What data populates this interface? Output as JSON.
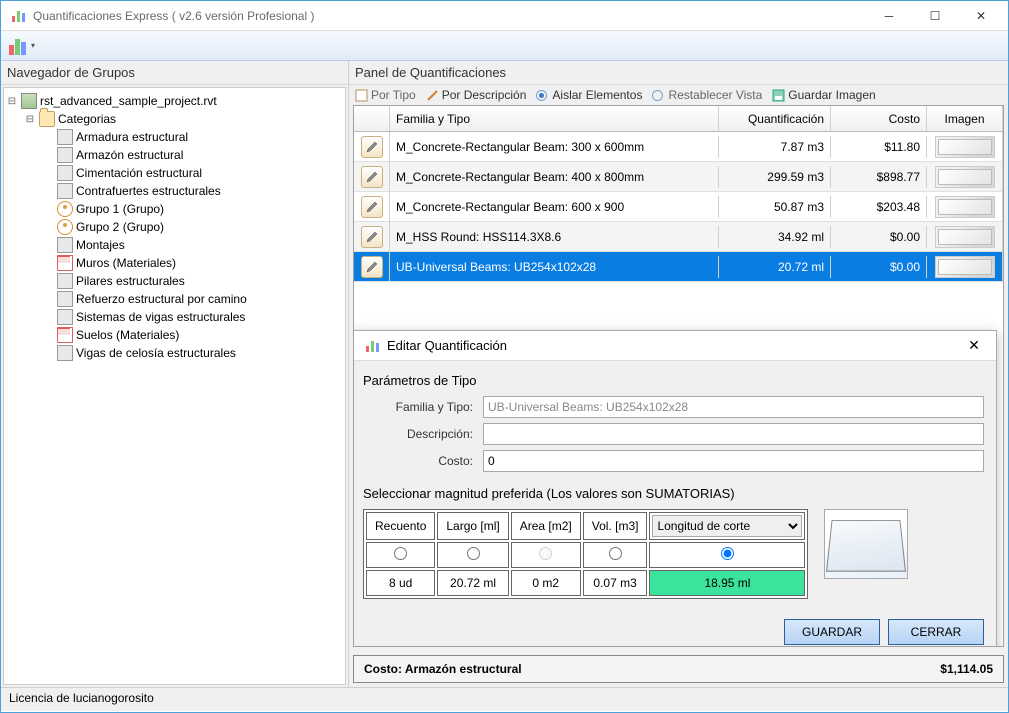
{
  "window": {
    "title": "Quantificaciones Express ( v2.6 versión Profesional )"
  },
  "nav": {
    "title": "Navegador de Grupos",
    "root": "rst_advanced_sample_project.rvt",
    "cat": "Categorias",
    "items": [
      {
        "label": "Armadura estructural",
        "icon": "igray"
      },
      {
        "label": "Armazón estructural",
        "icon": "igray"
      },
      {
        "label": "Cimentación estructural",
        "icon": "igray"
      },
      {
        "label": "Contrafuertes estructurales",
        "icon": "igray"
      },
      {
        "label": "Grupo 1 (Grupo)",
        "icon": "igrp"
      },
      {
        "label": "Grupo 2 (Grupo)",
        "icon": "igrp"
      },
      {
        "label": "Montajes",
        "icon": "igray"
      },
      {
        "label": "Muros (Materiales)",
        "icon": "imat"
      },
      {
        "label": "Pilares estructurales",
        "icon": "igray"
      },
      {
        "label": "Refuerzo estructural  por camino",
        "icon": "igray"
      },
      {
        "label": "Sistemas de vigas estructurales",
        "icon": "igray"
      },
      {
        "label": "Suelos (Materiales)",
        "icon": "imat"
      },
      {
        "label": "Vigas de celosía estructurales",
        "icon": "igray"
      }
    ]
  },
  "panel": {
    "title": "Panel de Quantificaciones",
    "btns": {
      "tipo": "Por Tipo",
      "desc": "Por Descripción",
      "aislar": "Aislar Elementos",
      "reset": "Restablecer Vista",
      "img": "Guardar Imagen"
    },
    "headers": {
      "name": "Familia y Tipo",
      "quant": "Quantificación",
      "cost": "Costo",
      "img": "Imagen"
    },
    "rows": [
      {
        "name": "M_Concrete-Rectangular Beam: 300 x 600mm",
        "quant": "7.87 m3",
        "cost": "$11.80"
      },
      {
        "name": "M_Concrete-Rectangular Beam: 400 x 800mm",
        "quant": "299.59 m3",
        "cost": "$898.77"
      },
      {
        "name": "M_Concrete-Rectangular Beam: 600 x 900",
        "quant": "50.87 m3",
        "cost": "$203.48"
      },
      {
        "name": "M_HSS Round: HSS114.3X8.6",
        "quant": "34.92 ml",
        "cost": "$0.00"
      },
      {
        "name": "UB-Universal Beams: UB254x102x28",
        "quant": "20.72 ml",
        "cost": "$0.00"
      }
    ],
    "total_label": "Costo: Armazón estructural",
    "total": "$1,114.05"
  },
  "dlg": {
    "title": "Editar Quantificación",
    "section": "Parámetros de Tipo",
    "familia_label": "Familia y Tipo:",
    "familia_val": "UB-Universal Beams: UB254x102x28",
    "desc_label": "Descripción:",
    "desc_val": "",
    "costo_label": "Costo:",
    "costo_val": "0",
    "mag_label": "Seleccionar magnitud preferida (Los valores son SUMATORIAS)",
    "cols": {
      "rec": "Recuento",
      "largo": "Largo [ml]",
      "area": "Area [m2]",
      "vol": "Vol. [m3]"
    },
    "select_val": "Longitud de corte",
    "vals": {
      "rec": "8 ud",
      "largo": "20.72 ml",
      "area": "0 m2",
      "vol": "0.07 m3",
      "extra": "18.95 ml"
    },
    "save": "GUARDAR",
    "close": "CERRAR"
  },
  "status": "Licencia de lucianogorosito"
}
